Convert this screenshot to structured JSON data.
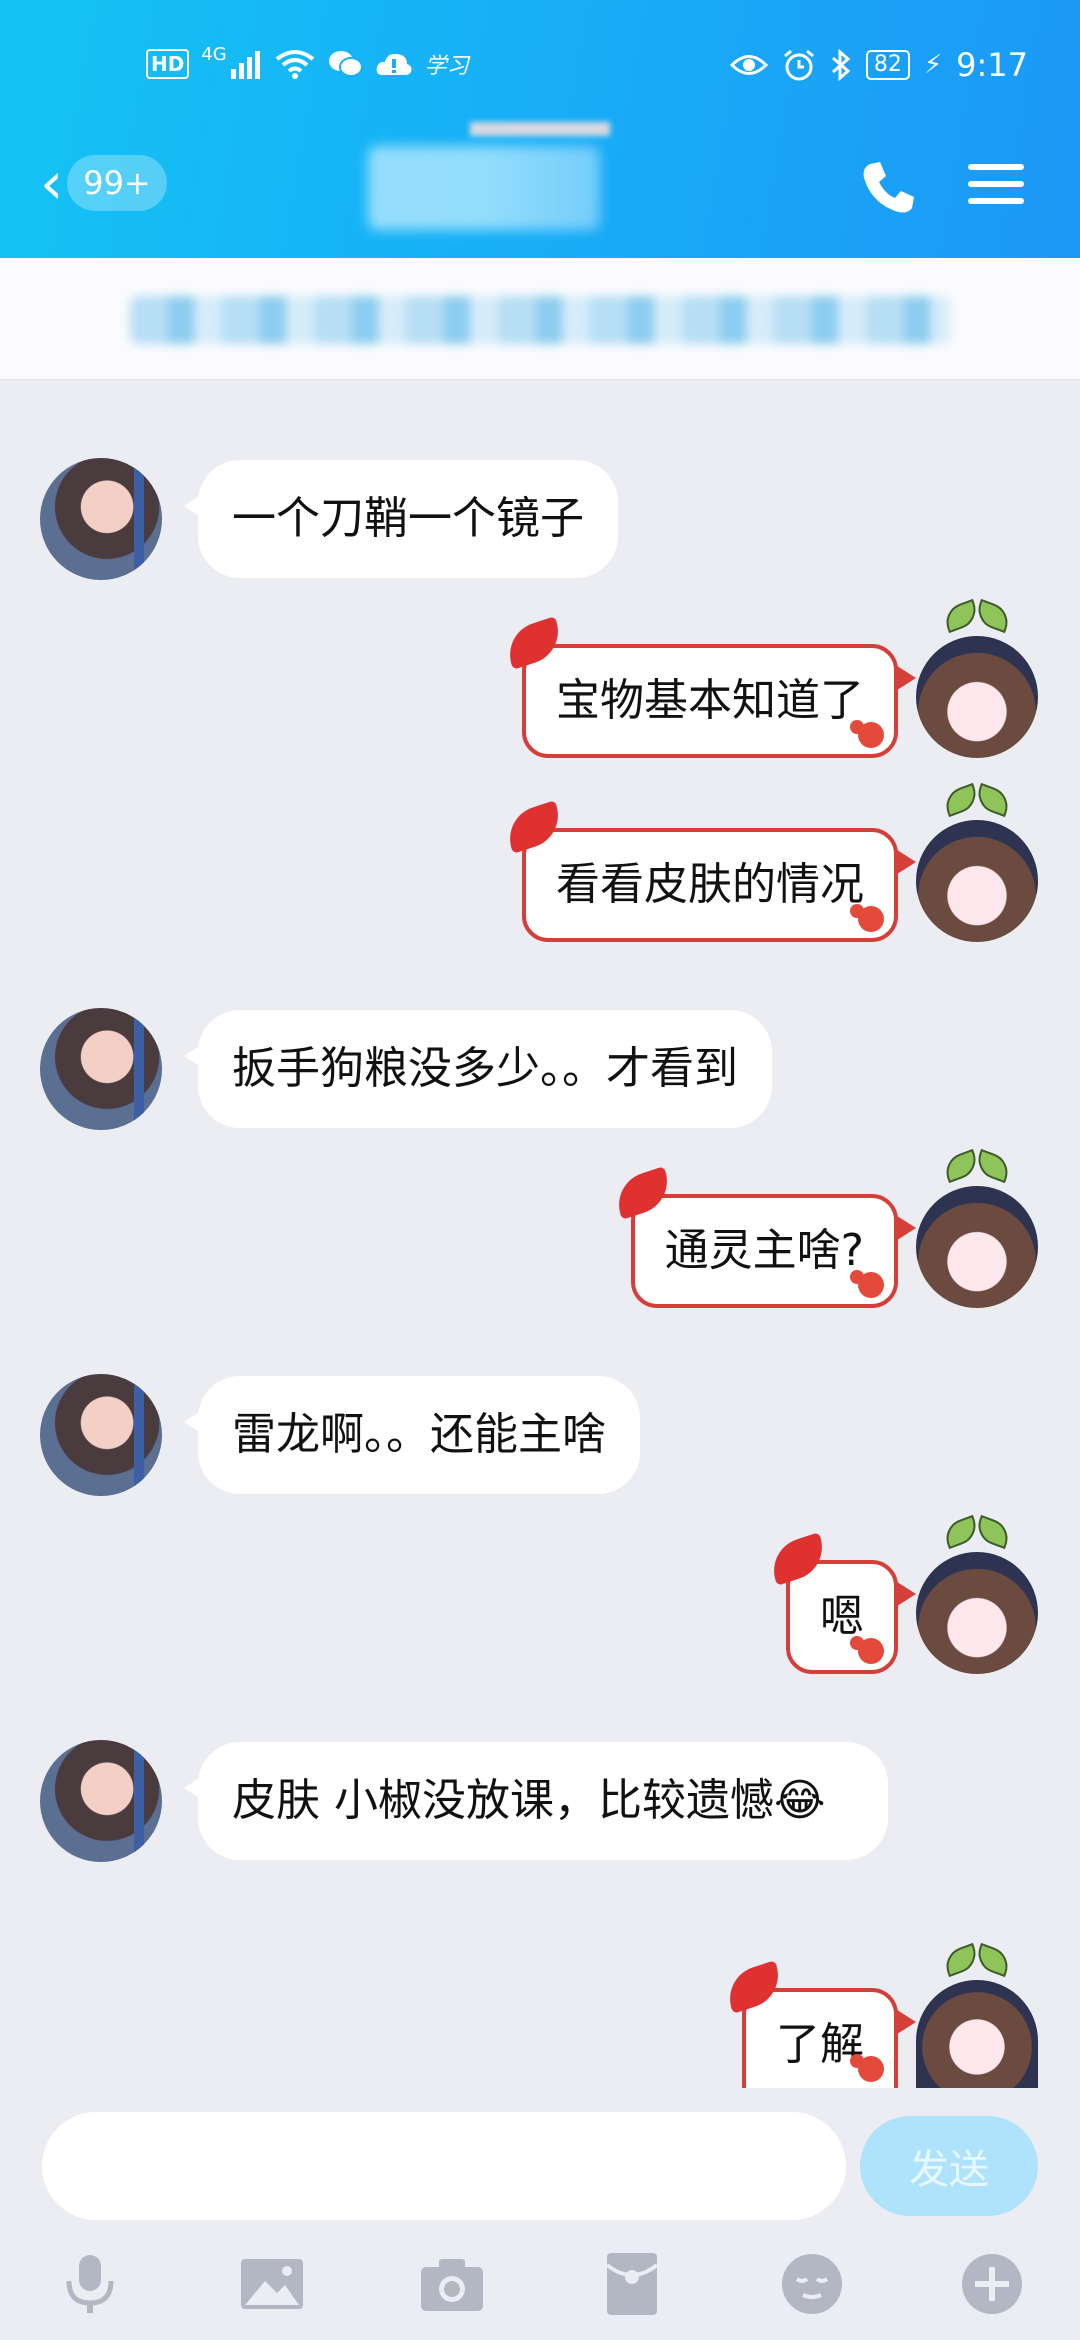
{
  "status_bar": {
    "network_badge": "HD",
    "network_type": "4G",
    "carrier_text": "学习",
    "battery": "82",
    "time": "9:17"
  },
  "header": {
    "unread_count": "99+"
  },
  "messages": [
    {
      "side": "left",
      "text": "一个刀鞘一个镜子"
    },
    {
      "side": "right",
      "text": "宝物基本知道了"
    },
    {
      "side": "right",
      "text": "看看皮肤的情况"
    },
    {
      "side": "left",
      "text": "扳手狗粮没多少。。才看到"
    },
    {
      "side": "right",
      "text": "通灵主啥?"
    },
    {
      "side": "left",
      "text": "雷龙啊。。还能主啥"
    },
    {
      "side": "right",
      "text": "嗯"
    },
    {
      "side": "left",
      "text": "皮肤 小椒没放课，比较遗憾😂"
    },
    {
      "side": "right",
      "text": "了解"
    }
  ],
  "input": {
    "value": "",
    "send_label": "发送"
  },
  "toolbar_icons": [
    "microphone-icon",
    "image-icon",
    "camera-icon",
    "red-packet-icon",
    "emoji-icon",
    "plus-icon"
  ],
  "colors": {
    "header_gradient_start": "#14c3f3",
    "header_gradient_end": "#1c98f6",
    "chat_background": "#ecedf3",
    "send_button": "#aee3fb",
    "bubble_border_right": "#d63e3a"
  }
}
